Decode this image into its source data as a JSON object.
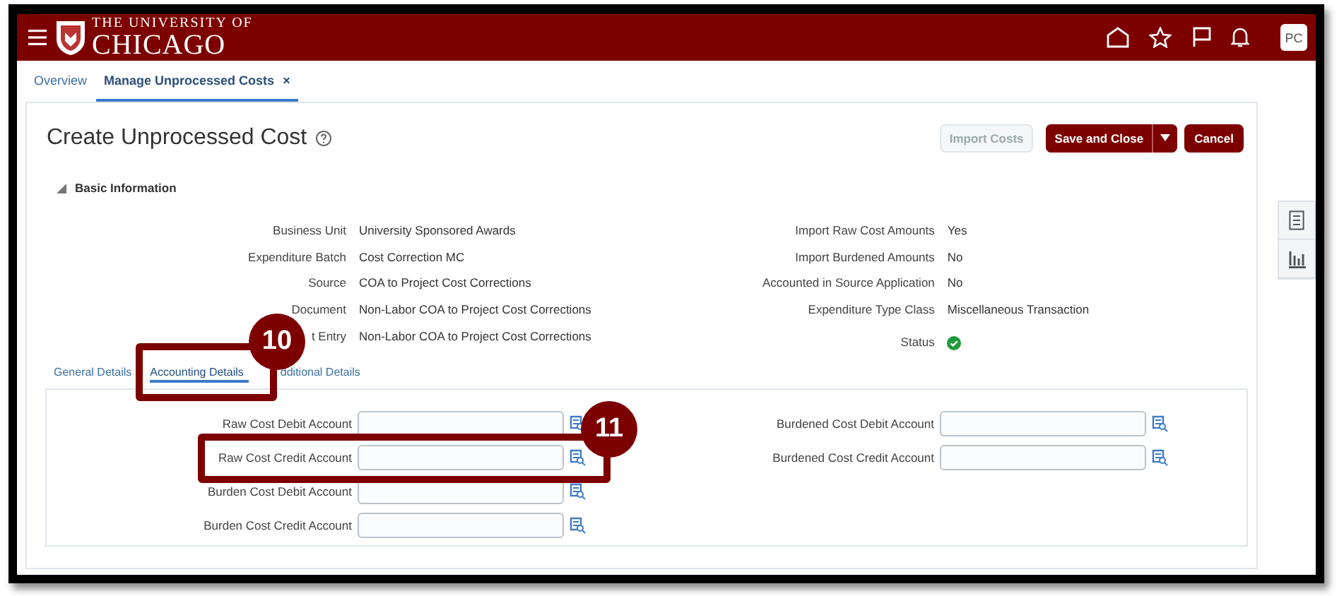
{
  "header": {
    "logo_small": "THE UNIVERSITY OF",
    "logo_large": "CHICAGO",
    "avatar": "PC"
  },
  "tabs": [
    {
      "label": "Overview",
      "selected": false
    },
    {
      "label": "Manage Unprocessed Costs",
      "selected": true,
      "close": "×"
    }
  ],
  "page": {
    "title": "Create Unprocessed Cost"
  },
  "buttons": [
    {
      "label": "Import Costs",
      "kind": "disabled"
    },
    {
      "label": "Save and Close",
      "kind": "split"
    },
    {
      "label": "Cancel",
      "kind": "primary"
    }
  ],
  "section": {
    "title": "Basic Information",
    "expanded": true
  },
  "info_left": [
    {
      "label": "Business Unit",
      "value": "University Sponsored Awards"
    },
    {
      "label": "Expenditure Batch",
      "value": "Cost Correction MC"
    },
    {
      "label": "Source",
      "value": "COA to Project Cost Corrections"
    },
    {
      "label": "Document",
      "value": "Non-Labor COA to Project Cost Corrections"
    },
    {
      "label": "t Entry",
      "value": "Non-Labor COA to Project Cost Corrections"
    }
  ],
  "info_right": [
    {
      "label": "Import Raw Cost Amounts",
      "value": "Yes",
      "kind": "text"
    },
    {
      "label": "Import Burdened Amounts",
      "value": "No",
      "kind": "text"
    },
    {
      "label": "Accounted in Source Application",
      "value": "No",
      "kind": "text"
    },
    {
      "label": "Expenditure Type Class",
      "value": "Miscellaneous Transaction",
      "kind": "text"
    },
    {
      "label": "Status",
      "kind": "status"
    }
  ],
  "detail_tabs": [
    {
      "label": "General Details",
      "selected": false
    },
    {
      "label": "Accounting Details",
      "selected": true
    },
    {
      "label": "dditional Details",
      "selected": false
    }
  ],
  "accounts_left": [
    {
      "label": "Raw Cost Debit Account"
    },
    {
      "label": "Raw Cost Credit Account"
    },
    {
      "label": "Burden Cost Debit Account"
    },
    {
      "label": "Burden Cost Credit Account"
    }
  ],
  "accounts_right": [
    {
      "label": "Burdened Cost Debit Account"
    },
    {
      "label": "Burdened Cost Credit Account"
    }
  ],
  "callouts": [
    {
      "number": "10"
    },
    {
      "number": "11"
    }
  ]
}
